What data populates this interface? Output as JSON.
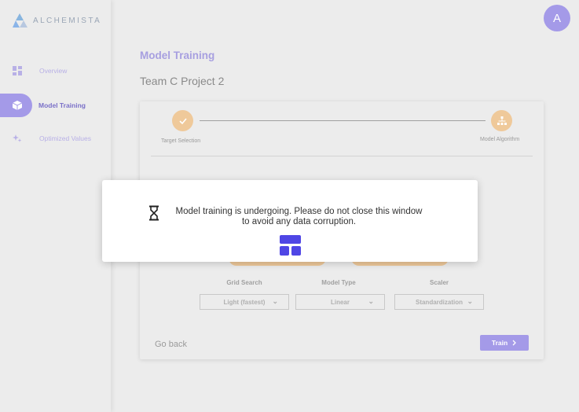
{
  "app": {
    "logo_text": "ALCHEMISTA"
  },
  "sidebar": {
    "items": [
      {
        "label": "Overview",
        "icon": "dashboard-icon",
        "active": false
      },
      {
        "label": "Model Training",
        "icon": "cube-icon",
        "active": true
      },
      {
        "label": "Optimized Values",
        "icon": "sparkle-icon",
        "active": false
      }
    ]
  },
  "user": {
    "avatar_initial": "A"
  },
  "page": {
    "title": "Model Training",
    "project": "Team C Project 2"
  },
  "stepper": {
    "steps": [
      {
        "label": "Target Selection",
        "state": "done",
        "icon": "check-icon"
      },
      {
        "label": "Model Algorithm",
        "state": "current",
        "icon": "hierarchy-icon"
      }
    ]
  },
  "fields": {
    "grid_search": {
      "label": "Grid Search",
      "value": "Light (fastest)"
    },
    "model_type": {
      "label": "Model Type",
      "value": "Linear"
    },
    "scaler": {
      "label": "Scaler",
      "value": "Standardization"
    }
  },
  "actions": {
    "go_back": "Go back",
    "train": "Train"
  },
  "modal": {
    "message": "Model training is undergoing. Please do not close this window to avoid any data corruption.",
    "icon": "hourglass-icon"
  },
  "colors": {
    "accent": "#a49ae8",
    "accent_dark": "#7a70c8",
    "step": "#efc99a",
    "background": "#ececec",
    "loader": "#4f46e5"
  }
}
